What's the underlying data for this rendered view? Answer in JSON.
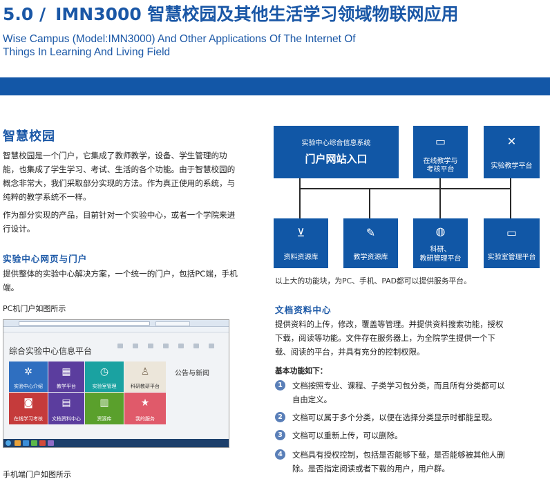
{
  "header": {
    "section_number": "5.0 /",
    "title": "IMN3000 智慧校园及其他生活学习领域物联网应用",
    "subtitle_line1": "Wise Campus (Model:IMN3000) And Other Applications Of The Internet Of",
    "subtitle_line2": "Things In Learning And Living Field",
    "band_color": "#1357a7"
  },
  "left": {
    "heading": "智慧校园",
    "intro_p1": "智慧校园是一个门户，它集成了教师教学，设备、学生管理的功能，也集成了学生学习、考试、生活的各个功能。由于智慧校园的概念非常大，我们采取部分实现的方法。作为真正使用的系统，与纯粹的教学系统不一样。",
    "intro_p2": "作为部分实现的产品，目前针对一个实验中心，或者一个学院来进行设计。",
    "sub_heading": "实验中心网页与门户",
    "sub_para": "提供整体的实验中心解决方案，一个统一的门户，包括PC端，手机端。",
    "pc_caption": "PC机门户如图所示",
    "mobile_caption": "手机端门户如图所示"
  },
  "screenshot": {
    "site_title": "综合实验中心信息平台",
    "news_title": "公告与新闻",
    "tiles": [
      {
        "label": "实验中心介绍",
        "color": "#2f6fc0",
        "icon": "gear-icon"
      },
      {
        "label": "教学平台",
        "color": "#5b3d9e",
        "icon": "calendar-icon"
      },
      {
        "label": "实验室管理",
        "color": "#1aa2a1",
        "icon": "clock-icon"
      },
      {
        "label": "科研教研平台",
        "color": "#ece6da",
        "icon": "user-icon"
      },
      {
        "label": "在线学习考核",
        "color": "#c53b3b",
        "icon": "safe-icon"
      },
      {
        "label": "文档资料中心",
        "color": "#5b3d9e",
        "icon": "document-icon"
      },
      {
        "label": "资源库",
        "color": "#5aa02c",
        "icon": "notebook-icon"
      },
      {
        "label": "我的服务",
        "color": "#e05a6a",
        "icon": "star-icon"
      }
    ]
  },
  "diagram": {
    "portal_line1": "实验中心综合信息系统",
    "portal_line2": "门户网站入口",
    "top_boxes": [
      {
        "label_line1": "在线教学与",
        "label_line2": "考核平台",
        "icon": "monitor-icon"
      },
      {
        "label": "实验教学平台",
        "icon": "tools-icon"
      }
    ],
    "bottom_boxes": [
      {
        "label": "资料资源库",
        "icon": "inbox-icon"
      },
      {
        "label": "教学资源库",
        "icon": "edit-icon"
      },
      {
        "label_line1": "科研、",
        "label_line2": "教研管理平台",
        "icon": "globe-icon"
      },
      {
        "label": "实验室管理平台",
        "icon": "display-icon"
      }
    ],
    "caption": "以上大的功能块，为PC、手机、PAD都可以提供服务平台。",
    "box_color": "#1157a6"
  },
  "doc_center": {
    "heading": "文档资料中心",
    "para": "提供资料的上传，修改，覆盖等管理。并提供资料搜索功能，授权下载，阅读等功能。文件存在服务器上，为全院学生提供一个下载、阅读的平台，并具有充分的控制权限。",
    "functions_title": "基本功能如下：",
    "items": [
      {
        "num": "1",
        "text": "文档按照专业、课程、子类学习包分类，而且所有分类都可以自由定义。"
      },
      {
        "num": "2",
        "text": "文档可以属于多个分类，以便在选择分类显示时都能呈现。"
      },
      {
        "num": "3",
        "text": "文档可以重新上传，可以删除。"
      },
      {
        "num": "4",
        "text": "文档具有授权控制，包括是否能够下载，是否能够被其他人删除。是否指定阅读或者下载的用户，用户群。"
      }
    ]
  }
}
